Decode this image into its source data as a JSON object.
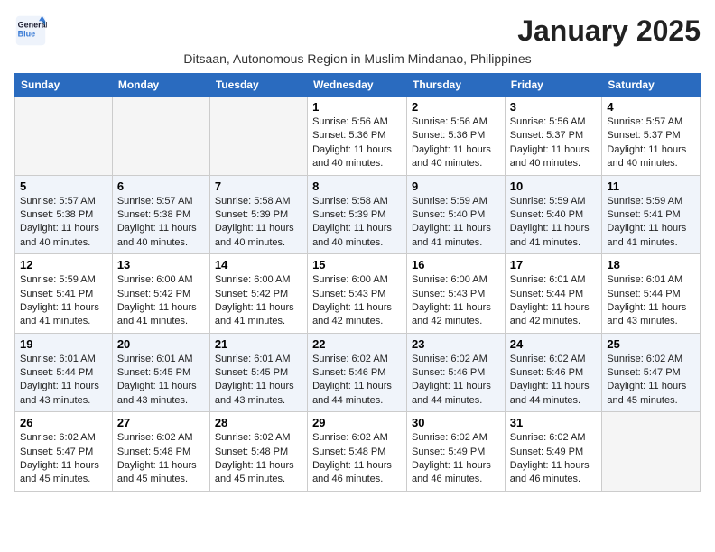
{
  "logo": {
    "line1": "General",
    "line2": "Blue",
    "tagline": "General\nBlue"
  },
  "title": "January 2025",
  "subtitle": "Ditsaan, Autonomous Region in Muslim Mindanao, Philippines",
  "weekdays": [
    "Sunday",
    "Monday",
    "Tuesday",
    "Wednesday",
    "Thursday",
    "Friday",
    "Saturday"
  ],
  "weeks": [
    [
      {
        "day": "",
        "sunrise": "",
        "sunset": "",
        "daylight": ""
      },
      {
        "day": "",
        "sunrise": "",
        "sunset": "",
        "daylight": ""
      },
      {
        "day": "",
        "sunrise": "",
        "sunset": "",
        "daylight": ""
      },
      {
        "day": "1",
        "sunrise": "Sunrise: 5:56 AM",
        "sunset": "Sunset: 5:36 PM",
        "daylight": "Daylight: 11 hours and 40 minutes."
      },
      {
        "day": "2",
        "sunrise": "Sunrise: 5:56 AM",
        "sunset": "Sunset: 5:36 PM",
        "daylight": "Daylight: 11 hours and 40 minutes."
      },
      {
        "day": "3",
        "sunrise": "Sunrise: 5:56 AM",
        "sunset": "Sunset: 5:37 PM",
        "daylight": "Daylight: 11 hours and 40 minutes."
      },
      {
        "day": "4",
        "sunrise": "Sunrise: 5:57 AM",
        "sunset": "Sunset: 5:37 PM",
        "daylight": "Daylight: 11 hours and 40 minutes."
      }
    ],
    [
      {
        "day": "5",
        "sunrise": "Sunrise: 5:57 AM",
        "sunset": "Sunset: 5:38 PM",
        "daylight": "Daylight: 11 hours and 40 minutes."
      },
      {
        "day": "6",
        "sunrise": "Sunrise: 5:57 AM",
        "sunset": "Sunset: 5:38 PM",
        "daylight": "Daylight: 11 hours and 40 minutes."
      },
      {
        "day": "7",
        "sunrise": "Sunrise: 5:58 AM",
        "sunset": "Sunset: 5:39 PM",
        "daylight": "Daylight: 11 hours and 40 minutes."
      },
      {
        "day": "8",
        "sunrise": "Sunrise: 5:58 AM",
        "sunset": "Sunset: 5:39 PM",
        "daylight": "Daylight: 11 hours and 40 minutes."
      },
      {
        "day": "9",
        "sunrise": "Sunrise: 5:59 AM",
        "sunset": "Sunset: 5:40 PM",
        "daylight": "Daylight: 11 hours and 41 minutes."
      },
      {
        "day": "10",
        "sunrise": "Sunrise: 5:59 AM",
        "sunset": "Sunset: 5:40 PM",
        "daylight": "Daylight: 11 hours and 41 minutes."
      },
      {
        "day": "11",
        "sunrise": "Sunrise: 5:59 AM",
        "sunset": "Sunset: 5:41 PM",
        "daylight": "Daylight: 11 hours and 41 minutes."
      }
    ],
    [
      {
        "day": "12",
        "sunrise": "Sunrise: 5:59 AM",
        "sunset": "Sunset: 5:41 PM",
        "daylight": "Daylight: 11 hours and 41 minutes."
      },
      {
        "day": "13",
        "sunrise": "Sunrise: 6:00 AM",
        "sunset": "Sunset: 5:42 PM",
        "daylight": "Daylight: 11 hours and 41 minutes."
      },
      {
        "day": "14",
        "sunrise": "Sunrise: 6:00 AM",
        "sunset": "Sunset: 5:42 PM",
        "daylight": "Daylight: 11 hours and 41 minutes."
      },
      {
        "day": "15",
        "sunrise": "Sunrise: 6:00 AM",
        "sunset": "Sunset: 5:43 PM",
        "daylight": "Daylight: 11 hours and 42 minutes."
      },
      {
        "day": "16",
        "sunrise": "Sunrise: 6:00 AM",
        "sunset": "Sunset: 5:43 PM",
        "daylight": "Daylight: 11 hours and 42 minutes."
      },
      {
        "day": "17",
        "sunrise": "Sunrise: 6:01 AM",
        "sunset": "Sunset: 5:44 PM",
        "daylight": "Daylight: 11 hours and 42 minutes."
      },
      {
        "day": "18",
        "sunrise": "Sunrise: 6:01 AM",
        "sunset": "Sunset: 5:44 PM",
        "daylight": "Daylight: 11 hours and 43 minutes."
      }
    ],
    [
      {
        "day": "19",
        "sunrise": "Sunrise: 6:01 AM",
        "sunset": "Sunset: 5:44 PM",
        "daylight": "Daylight: 11 hours and 43 minutes."
      },
      {
        "day": "20",
        "sunrise": "Sunrise: 6:01 AM",
        "sunset": "Sunset: 5:45 PM",
        "daylight": "Daylight: 11 hours and 43 minutes."
      },
      {
        "day": "21",
        "sunrise": "Sunrise: 6:01 AM",
        "sunset": "Sunset: 5:45 PM",
        "daylight": "Daylight: 11 hours and 43 minutes."
      },
      {
        "day": "22",
        "sunrise": "Sunrise: 6:02 AM",
        "sunset": "Sunset: 5:46 PM",
        "daylight": "Daylight: 11 hours and 44 minutes."
      },
      {
        "day": "23",
        "sunrise": "Sunrise: 6:02 AM",
        "sunset": "Sunset: 5:46 PM",
        "daylight": "Daylight: 11 hours and 44 minutes."
      },
      {
        "day": "24",
        "sunrise": "Sunrise: 6:02 AM",
        "sunset": "Sunset: 5:46 PM",
        "daylight": "Daylight: 11 hours and 44 minutes."
      },
      {
        "day": "25",
        "sunrise": "Sunrise: 6:02 AM",
        "sunset": "Sunset: 5:47 PM",
        "daylight": "Daylight: 11 hours and 45 minutes."
      }
    ],
    [
      {
        "day": "26",
        "sunrise": "Sunrise: 6:02 AM",
        "sunset": "Sunset: 5:47 PM",
        "daylight": "Daylight: 11 hours and 45 minutes."
      },
      {
        "day": "27",
        "sunrise": "Sunrise: 6:02 AM",
        "sunset": "Sunset: 5:48 PM",
        "daylight": "Daylight: 11 hours and 45 minutes."
      },
      {
        "day": "28",
        "sunrise": "Sunrise: 6:02 AM",
        "sunset": "Sunset: 5:48 PM",
        "daylight": "Daylight: 11 hours and 45 minutes."
      },
      {
        "day": "29",
        "sunrise": "Sunrise: 6:02 AM",
        "sunset": "Sunset: 5:48 PM",
        "daylight": "Daylight: 11 hours and 46 minutes."
      },
      {
        "day": "30",
        "sunrise": "Sunrise: 6:02 AM",
        "sunset": "Sunset: 5:49 PM",
        "daylight": "Daylight: 11 hours and 46 minutes."
      },
      {
        "day": "31",
        "sunrise": "Sunrise: 6:02 AM",
        "sunset": "Sunset: 5:49 PM",
        "daylight": "Daylight: 11 hours and 46 minutes."
      },
      {
        "day": "",
        "sunrise": "",
        "sunset": "",
        "daylight": ""
      }
    ]
  ]
}
